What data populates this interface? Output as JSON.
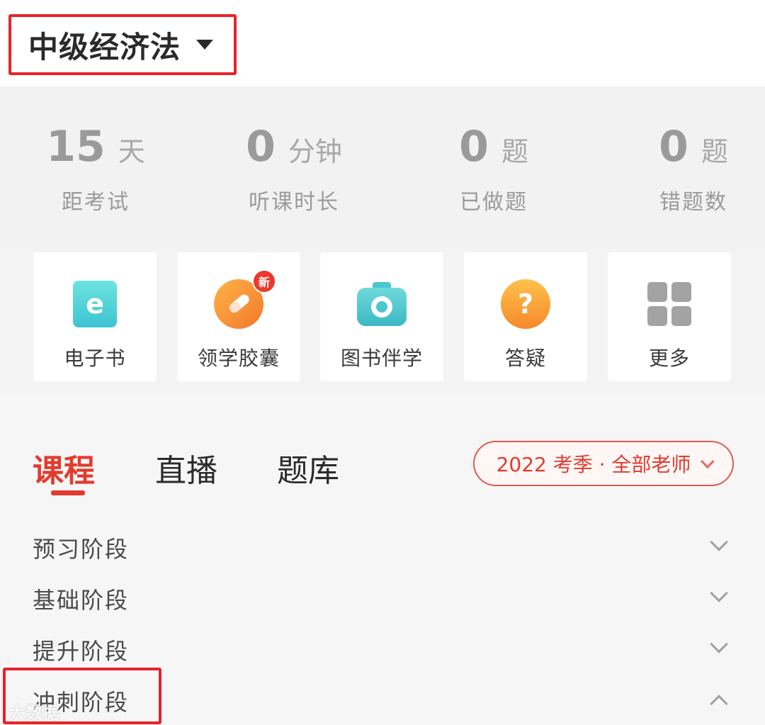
{
  "header": {
    "title": "中级经济法"
  },
  "stats": [
    {
      "value": "15",
      "unit": "天",
      "label": "距考试"
    },
    {
      "value": "0",
      "unit": "分钟",
      "label": "听课时长"
    },
    {
      "value": "0",
      "unit": "题",
      "label": "已做题"
    },
    {
      "value": "0",
      "unit": "题",
      "label": "错题数"
    }
  ],
  "tools": [
    {
      "label": "电子书",
      "icon": "ebook-icon"
    },
    {
      "label": "领学胶囊",
      "icon": "capsule-icon",
      "badge": "新"
    },
    {
      "label": "图书伴学",
      "icon": "camera-icon"
    },
    {
      "label": "答疑",
      "icon": "question-icon"
    },
    {
      "label": "更多",
      "icon": "grid-icon"
    }
  ],
  "tabs": [
    {
      "label": "课程",
      "active": true
    },
    {
      "label": "直播",
      "active": false
    },
    {
      "label": "题库",
      "active": false
    }
  ],
  "filter": {
    "label": "2022 考季 · 全部老师"
  },
  "stages": [
    {
      "label": "预习阶段",
      "expanded": false
    },
    {
      "label": "基础阶段",
      "expanded": false
    },
    {
      "label": "提升阶段",
      "expanded": false
    },
    {
      "label": "冲刺阶段",
      "expanded": true
    }
  ],
  "watermark": "大数据",
  "colors": {
    "accent": "#e23b2e",
    "highlight": "#e8222a"
  }
}
